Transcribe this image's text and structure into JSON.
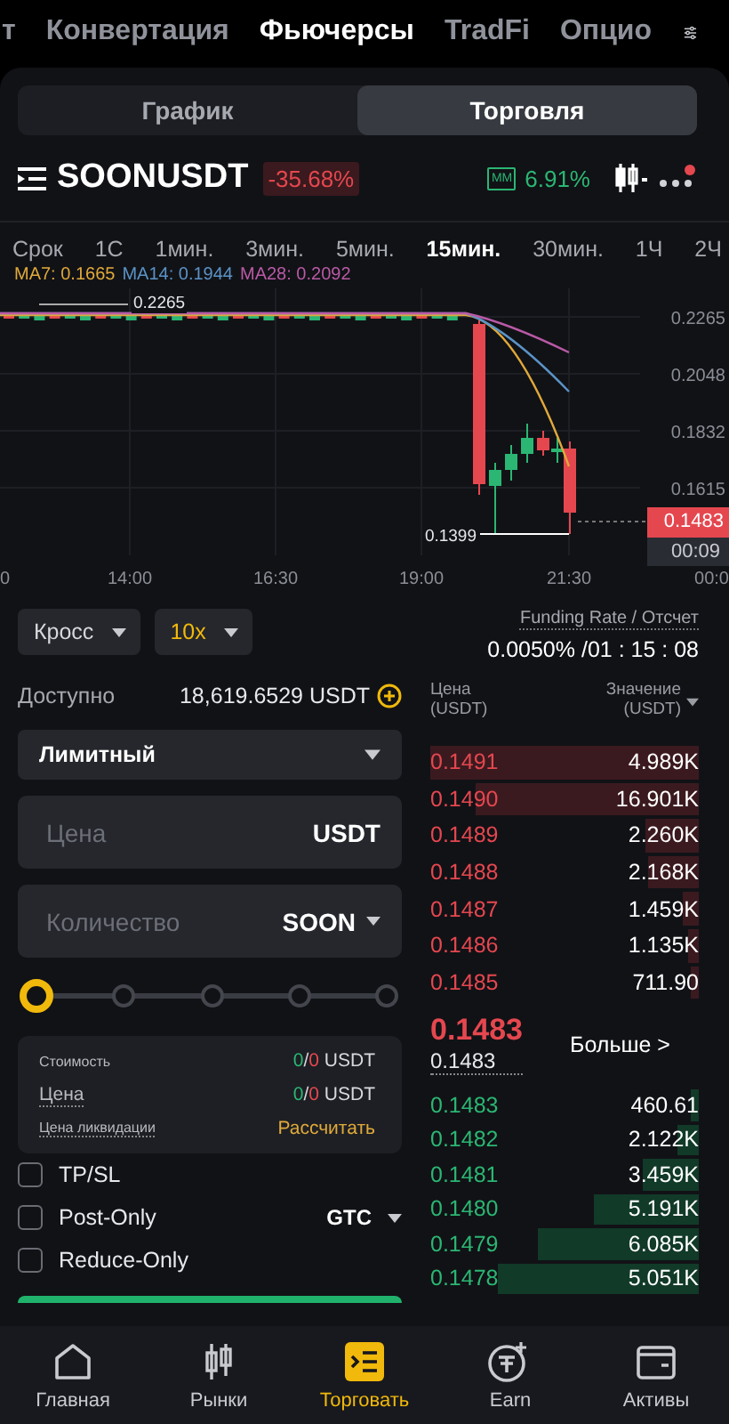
{
  "top_tabs": [
    {
      "label": "т",
      "selected": false
    },
    {
      "label": "Конвертация",
      "selected": false
    },
    {
      "label": "Фьючерсы",
      "selected": true
    },
    {
      "label": "TradFi",
      "selected": false
    },
    {
      "label": "Опцио",
      "selected": false
    }
  ],
  "view_tabs": [
    {
      "label": "График",
      "selected": false
    },
    {
      "label": "Торговля",
      "selected": true
    }
  ],
  "symbol": {
    "name": "SOONUSDT",
    "change": "-35.68%",
    "mm_badge": "MM",
    "mm_rate": "6.91%"
  },
  "timeframes": [
    {
      "label": "Срок",
      "selected": false
    },
    {
      "label": "1С",
      "selected": false
    },
    {
      "label": "1мин.",
      "selected": false
    },
    {
      "label": "3мин.",
      "selected": false
    },
    {
      "label": "5мин.",
      "selected": false
    },
    {
      "label": "15мин.",
      "selected": true
    },
    {
      "label": "30мин.",
      "selected": false
    },
    {
      "label": "1Ч",
      "selected": false
    },
    {
      "label": "2Ч",
      "selected": false
    }
  ],
  "indicators": [
    {
      "label": "MA7: 0.1665",
      "color": "#e0a93a"
    },
    {
      "label": "MA14: 0.1944",
      "color": "#5b93c7"
    },
    {
      "label": "MA28: 0.2092",
      "color": "#b95aa6"
    }
  ],
  "chart": {
    "y_labels": [
      "0.2265",
      "0.2048",
      "0.1832",
      "0.1615"
    ],
    "x_labels": [
      "0",
      "14:00",
      "16:30",
      "19:00",
      "21:30",
      "00:0"
    ],
    "high_label": "0.2265",
    "low_label": "0.1399",
    "last_price": "0.1483",
    "countdown": "00:09"
  },
  "order_form": {
    "margin_mode": "Кросс",
    "leverage": "10x",
    "available_label": "Доступно",
    "available_value": "18,619.6529 USDT",
    "order_type": "Лимитный",
    "price_field": {
      "placeholder": "Цена",
      "unit": "USDT"
    },
    "qty_field": {
      "placeholder": "Количество",
      "unit": "SOON"
    },
    "slider": {
      "level": 0
    },
    "summary": [
      {
        "kind": "split",
        "label": "Стоимость",
        "long": "0",
        "separator": "/",
        "short": "0",
        "unit": "USDT"
      },
      {
        "kind": "split",
        "label": "Цена",
        "long": "0",
        "separator": "/",
        "short": "0",
        "unit": "USDT"
      },
      {
        "kind": "action",
        "label": "Цена ликвидации",
        "action": "Рассчитать"
      }
    ],
    "options": [
      {
        "label": "TP/SL",
        "checked": false
      },
      {
        "label": "Post-Only",
        "checked": false,
        "select": "GTC"
      },
      {
        "label": "Reduce-Only",
        "checked": false
      }
    ]
  },
  "funding": {
    "label": "Funding Rate / Отсчет",
    "value": "0.0050% /01 : 15 : 08"
  },
  "orderbook": {
    "price_header": "Цена (USDT)",
    "value_header": "Значение (USDT)",
    "asks": [
      {
        "price": "0.1491",
        "value": "4.989K"
      },
      {
        "price": "0.1490",
        "value": "16.901K"
      },
      {
        "price": "0.1489",
        "value": "2.260K"
      },
      {
        "price": "0.1488",
        "value": "2.168K"
      },
      {
        "price": "0.1487",
        "value": "1.459K"
      },
      {
        "price": "0.1486",
        "value": "1.135K"
      },
      {
        "price": "0.1485",
        "value": "711.90"
      }
    ],
    "last_price": "0.1483",
    "mark_price": "0.1483",
    "more": "Больше >",
    "bids": [
      {
        "price": "0.1483",
        "value": "460.61"
      },
      {
        "price": "0.1482",
        "value": "2.122K"
      },
      {
        "price": "0.1481",
        "value": "3.459K"
      },
      {
        "price": "0.1480",
        "value": "5.191K"
      },
      {
        "price": "0.1479",
        "value": "6.085K"
      },
      {
        "price": "0.1478",
        "value": "5.051K"
      }
    ]
  },
  "bottom_nav": [
    {
      "label": "Главная",
      "selected": false
    },
    {
      "label": "Рынки",
      "selected": false
    },
    {
      "label": "Торговать",
      "selected": true
    },
    {
      "label": "Earn",
      "selected": false
    },
    {
      "label": "Активы",
      "selected": false
    }
  ]
}
